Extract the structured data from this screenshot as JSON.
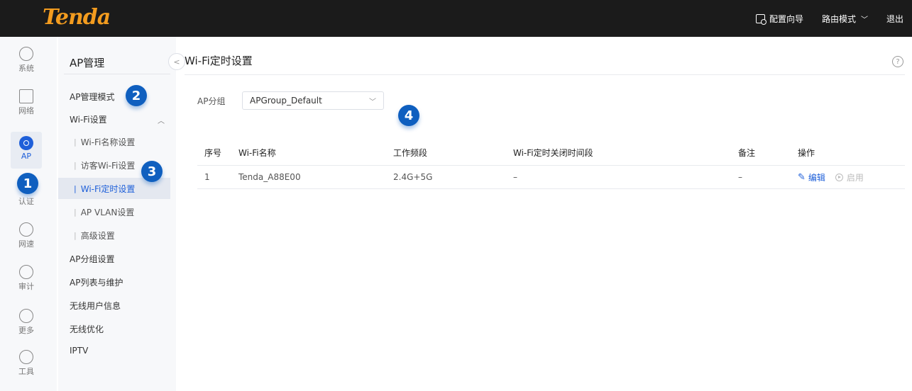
{
  "topbar": {
    "logo": "Tenda",
    "setup_wizard": "配置向导",
    "mode": "路由模式",
    "logout": "退出"
  },
  "rail": {
    "items": [
      {
        "label": "系统",
        "icon": "system-icon"
      },
      {
        "label": "网络",
        "icon": "network-icon"
      },
      {
        "label": "AP",
        "icon": "ap-icon"
      },
      {
        "label": "认证",
        "icon": "auth-icon"
      },
      {
        "label": "网速",
        "icon": "speed-icon"
      },
      {
        "label": "审计",
        "icon": "audit-icon"
      },
      {
        "label": "更多",
        "icon": "more-icon"
      },
      {
        "label": "工具",
        "icon": "tools-icon"
      }
    ]
  },
  "sidebar": {
    "title": "AP管理",
    "items": {
      "ap_mode": "AP管理模式",
      "wifi_settings": "Wi-Fi设置",
      "wifi_name": "Wi-Fi名称设置",
      "guest_wifi": "访客Wi-Fi设置",
      "wifi_timer": "Wi-Fi定时设置",
      "ap_vlan": "AP VLAN设置",
      "advanced": "高级设置",
      "ap_group": "AP分组设置",
      "ap_list": "AP列表与维护",
      "wireless_users": "无线用户信息",
      "wireless_opt": "无线优化",
      "iptv": "IPTV"
    }
  },
  "badges": [
    "1",
    "2",
    "3",
    "4"
  ],
  "main": {
    "title": "Wi-Fi定时设置",
    "group_label": "AP分组",
    "group_value": "APGroup_Default",
    "table": {
      "headers": [
        "序号",
        "Wi-Fi名称",
        "工作频段",
        "Wi-Fi定时关闭时间段",
        "备注",
        "操作"
      ],
      "rows": [
        {
          "index": "1",
          "name": "Tenda_A88E00",
          "band": "2.4G+5G",
          "period": "–",
          "remark": "–",
          "edit": "编辑",
          "enable": "启用"
        }
      ]
    }
  },
  "colors": {
    "accent": "#1e5fd9",
    "badge": "#0f5fbf",
    "logo": "#f39c1f",
    "topbar": "#1b1b1b"
  }
}
